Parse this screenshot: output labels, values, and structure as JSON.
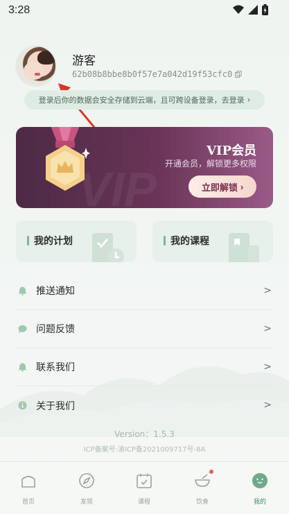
{
  "status_bar": {
    "time": "3:28"
  },
  "profile": {
    "name": "游客",
    "user_id": "62b08b8bbe8b0f57e7a042d19f53cfc0"
  },
  "login_tip": {
    "text": "登录后你的数据会安全存储到云端，且可跨设备登录，去登录",
    "chevron": "›"
  },
  "vip": {
    "title": "VIP会员",
    "subtitle": "开通会员，解锁更多权限",
    "button": "立即解锁",
    "watermark": "VIP"
  },
  "quick_cards": [
    {
      "label": "我的计划"
    },
    {
      "label": "我的课程"
    }
  ],
  "menu": [
    {
      "label": "推送通知",
      "icon": "bell-icon"
    },
    {
      "label": "问题反馈",
      "icon": "chat-bubble-icon"
    },
    {
      "label": "联系我们",
      "icon": "bell-icon"
    },
    {
      "label": "关于我们",
      "icon": "info-icon"
    }
  ],
  "footer": {
    "version": "Version：1.5.3",
    "icp": "ICP备案号:渝ICP备2021009717号-8A"
  },
  "tabs": [
    {
      "label": "首页",
      "icon": "home-icon"
    },
    {
      "label": "发现",
      "icon": "compass-icon"
    },
    {
      "label": "课程",
      "icon": "calendar-check-icon"
    },
    {
      "label": "饮食",
      "icon": "bowl-icon"
    },
    {
      "label": "我的",
      "icon": "face-icon"
    }
  ],
  "colors": {
    "accent": "#3f8a66",
    "vip_bg": "#6a3457",
    "notification_dot": "#ef5a4a"
  }
}
